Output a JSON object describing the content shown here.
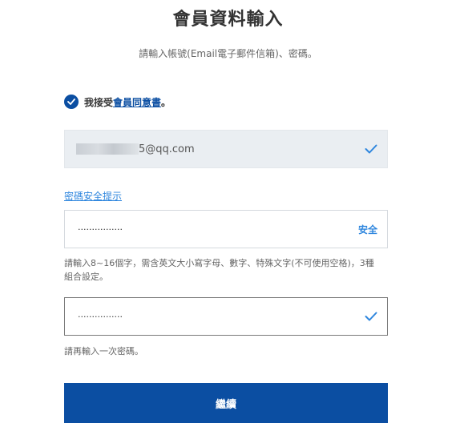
{
  "header": {
    "title": "會員資料輸入",
    "subtitle": "請輸入帳號(Email電子郵件信箱)、密碼。"
  },
  "agreement": {
    "prefix": "我接受",
    "link_text": "會員同意書",
    "suffix": "。",
    "checked": true
  },
  "email_field": {
    "visible_value": "5@qq.com",
    "status_icon": "checkmark-icon"
  },
  "password_hint_link": "密碼安全提示",
  "password_field": {
    "value_mask": "················",
    "strength_label": "安全"
  },
  "password_help": "請輸入8~16個字，需含英文大小寫字母、數字、特殊文字(不可使用空格)，3種組合設定。",
  "confirm_field": {
    "value_mask": "················",
    "status_icon": "checkmark-icon"
  },
  "confirm_help": "請再輸入一次密碼。",
  "continue_button": "繼續",
  "colors": {
    "primary": "#0b4ea2",
    "accent": "#2e86de",
    "filled_bg": "#eaeef2"
  }
}
